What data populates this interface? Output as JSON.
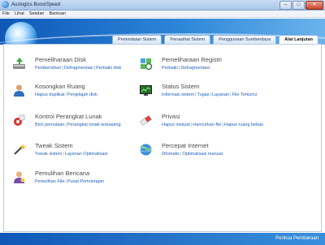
{
  "window": {
    "title": "Auslogics BoostSpeed",
    "minimize": "–",
    "maximize": "□",
    "close": "✕"
  },
  "menu": [
    "File",
    "Lihat",
    "Setelan",
    "Bantuan"
  ],
  "tabs": [
    {
      "label": "Pemindaian Sistem",
      "active": false
    },
    {
      "label": "Penasihat Sistem",
      "active": false
    },
    {
      "label": "Penggunaan Sumberdaya",
      "active": false
    },
    {
      "label": "Alat Lanjutan",
      "active": true
    }
  ],
  "sections": [
    {
      "title": "Pemeliharaan Disk",
      "icon": "disk-cleanup-icon",
      "links": [
        "Pembersihan",
        "Defragmentasi",
        "Perbaiki disk"
      ]
    },
    {
      "title": "Pemeliharaan Registri",
      "icon": "registry-icon",
      "links": [
        "Perbaiki",
        "Defragmentasi"
      ]
    },
    {
      "title": "Kosongkan Ruang",
      "icon": "user-space-icon",
      "links": [
        "Hapus duplikat",
        "Penjelajah disk"
      ]
    },
    {
      "title": "Status Sistem",
      "icon": "monitor-chart-icon",
      "links": [
        "Informasi sistem",
        "Tugas",
        "Layanan",
        "File Terkunci"
      ]
    },
    {
      "title": "Kontrol Perangkat Lunak",
      "icon": "software-control-icon",
      "links": [
        "Bisn pemulaan",
        "Perangkat lunak terpasang"
      ]
    },
    {
      "title": "Privasi",
      "icon": "eraser-icon",
      "links": [
        "Hapus riwayat",
        "Hancurkan file",
        "Hapus ruang bebas"
      ]
    },
    {
      "title": "Tweak Sistem",
      "icon": "wand-icon",
      "links": [
        "Tweak sistem",
        "Layanan Optimalisasi"
      ]
    },
    {
      "title": "Percepat Internet",
      "icon": "globe-speed-icon",
      "links": [
        "Otomatis",
        "Optimalisasi manual"
      ]
    },
    {
      "title": "Pemulihan Bencana",
      "icon": "rescue-icon",
      "links": [
        "Pemulihan File",
        "Pusat Pertolongan"
      ]
    }
  ],
  "footer": {
    "button": "Periksa Pembaruan"
  }
}
